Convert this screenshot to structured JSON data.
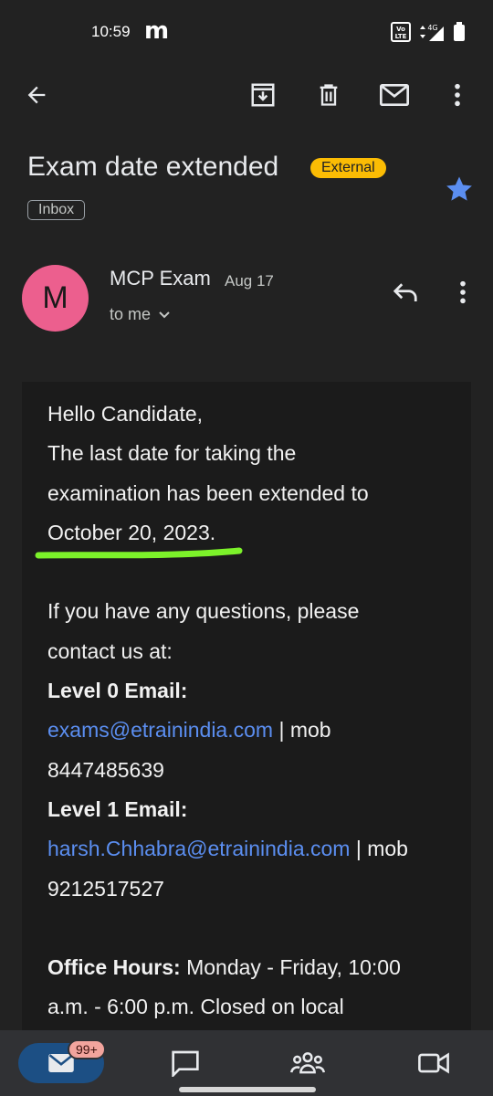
{
  "status_bar": {
    "time": "10:59",
    "carrier_glyph": "m",
    "network_label": "Vo LTE",
    "network_type": "4G"
  },
  "toolbar": {
    "icons": [
      "back-arrow-icon",
      "archive-icon",
      "trash-icon",
      "mark-unread-icon",
      "more-vert-icon"
    ]
  },
  "email": {
    "subject": "Exam date extended",
    "external_label": "External",
    "folder_label": "Inbox",
    "starred": true,
    "sender_initial": "M",
    "sender_name": "MCP Exam",
    "date": "Aug 17",
    "recipient": "to me",
    "body": {
      "greeting": "Hello Candidate,",
      "line1": "The last date for taking the",
      "line2": "examination has been extended to",
      "line3": "October 20, 2023.",
      "questions1": "If you have any questions, please",
      "questions2": "contact us at:",
      "level0_label": "Level 0 Email:",
      "level0_email": "exams@etrainindia.com",
      "level0_sep": " | mob",
      "level0_phone": "8447485639",
      "level1_label": "Level 1 Email:",
      "level1_email": "harsh.Chhabra@etrainindia.com",
      "level1_sep": " | mob",
      "level1_phone": "9212517527",
      "hours_label": "Office Hours:",
      "hours_text1": " Monday - Friday, 10:00",
      "hours_text2": "a.m. - 6:00 p.m. Closed on local"
    }
  },
  "bottom_nav": {
    "mail_badge": "99+",
    "items": [
      "mail-icon",
      "chat-icon",
      "spaces-icon",
      "meet-icon"
    ]
  },
  "colors": {
    "background": "#222222",
    "body_bg": "#1b1b1b",
    "link": "#5b8ef0",
    "external_badge": "#fbbc04",
    "avatar": "#ec5f8e",
    "star": "#5b8ef0",
    "highlight": "#7cf22a"
  }
}
